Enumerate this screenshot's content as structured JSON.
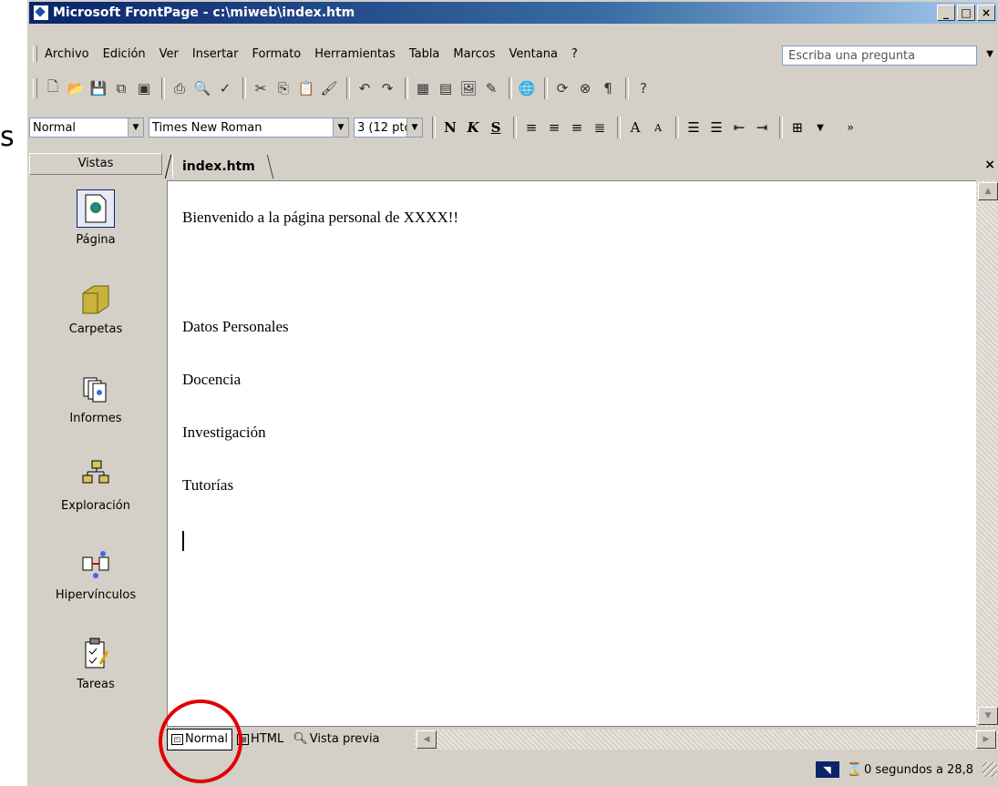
{
  "window": {
    "title": "Microsoft FrontPage - c:\\miweb\\index.htm"
  },
  "menu": {
    "items": [
      "Archivo",
      "Edición",
      "Ver",
      "Insertar",
      "Formato",
      "Herramientas",
      "Tabla",
      "Marcos",
      "Ventana",
      "?"
    ],
    "ask_placeholder": "Escriba una pregunta"
  },
  "format": {
    "style": "Normal",
    "font": "Times New Roman",
    "size": "3 (12 pto"
  },
  "views": {
    "header": "Vistas",
    "items": [
      "Página",
      "Carpetas",
      "Informes",
      "Exploración",
      "Hipervínculos",
      "Tareas"
    ]
  },
  "document": {
    "tab": "index.htm",
    "lines": [
      "Bienvenido a la página personal de XXXX!!",
      "Datos Personales",
      "Docencia",
      "Investigación",
      "Tutorías"
    ]
  },
  "view_tabs": [
    "Normal",
    "HTML",
    "Vista previa"
  ],
  "status": {
    "text": "0 segundos a 28,8"
  },
  "edge_glyph": "s",
  "colors": {
    "title_bar": "#0a246a",
    "annotation_circle": "#e00000"
  }
}
